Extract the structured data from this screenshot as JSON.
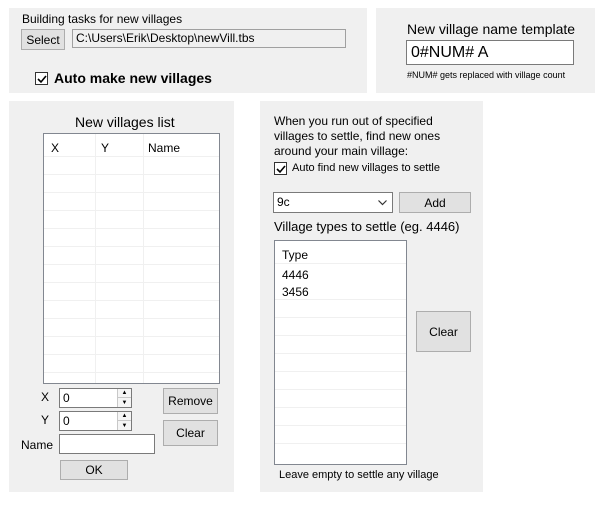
{
  "building": {
    "label": "Building tasks for new villages",
    "select_label": "Select",
    "path_value": "C:\\Users\\Erik\\Desktop\\newVill.tbs",
    "auto_make_label": "Auto make new villages",
    "auto_make_checked": true
  },
  "template": {
    "title": "New village name template",
    "value": "0#NUM# A",
    "hint": "#NUM# gets replaced with village count"
  },
  "villages_list": {
    "title": "New villages list",
    "columns": [
      "X",
      "Y",
      "Name"
    ],
    "x_label": "X",
    "x_value": "0",
    "y_label": "Y",
    "y_value": "0",
    "name_label": "Name",
    "name_value": "",
    "remove_label": "Remove",
    "clear_label": "Clear",
    "ok_label": "OK"
  },
  "settle": {
    "description_line1": "When you run out of specified",
    "description_line2": "villages to settle, find new ones",
    "description_line3": "around your main village:",
    "auto_find_label": "Auto find new villages to settle",
    "auto_find_checked": true,
    "dropdown_value": "9c",
    "add_label": "Add",
    "types_title": "Village types to settle (eg. 4446)",
    "types_header": "Type",
    "types": [
      "4446",
      "3456"
    ],
    "clear_label": "Clear",
    "footer": "Leave empty to settle any village"
  }
}
